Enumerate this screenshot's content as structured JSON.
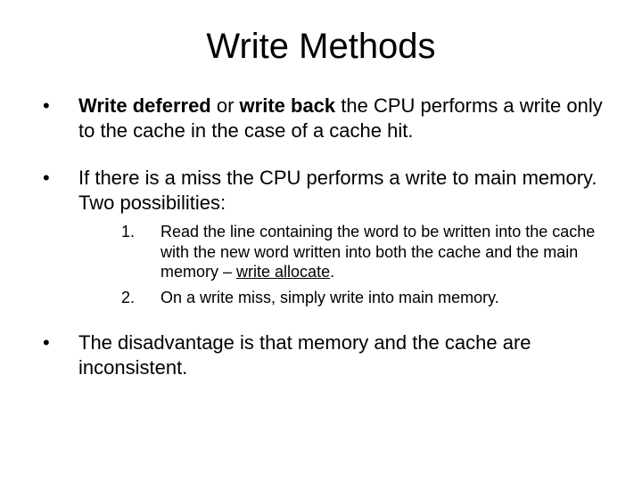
{
  "title": "Write Methods",
  "bullet1": {
    "bold1": "Write deferred",
    "mid": " or ",
    "bold2": "write back",
    "rest": " the CPU performs a write only to the cache in the case of a cache hit."
  },
  "bullet2": "If there is a miss the CPU performs a write to main memory. Two possibilities:",
  "sub1": {
    "num": "1.",
    "pre": "Read the line containing the word to be written into the cache with the new word written into  both the cache and the main memory – ",
    "under": "write allocate",
    "post": "."
  },
  "sub2": {
    "num": "2.",
    "text": "On a write miss, simply write into main memory."
  },
  "bullet3": "The disadvantage is that memory and the cache are inconsistent."
}
